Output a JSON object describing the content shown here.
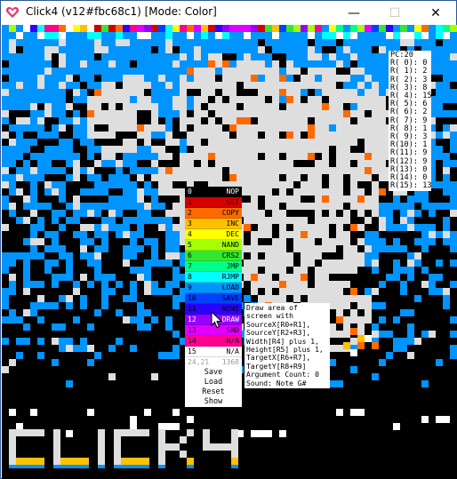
{
  "window": {
    "title": "Click4 (v12#fbc68c1) [Mode: Color]",
    "app_icon": "heart-icon",
    "controls": {
      "minimize": "—",
      "maximize": "☐",
      "close": "✕"
    }
  },
  "registers": {
    "pc": "PC:20",
    "lines": [
      "R( 0): 0",
      "R( 1): 2",
      "R( 2): 3",
      "R( 3): 8",
      "R( 4): 15",
      "R( 5): 6",
      "R( 6): 2",
      "R( 7): 9",
      "R( 8): 1",
      "R( 9): 3",
      "R(10): 1",
      "R(11): 9",
      "R(12): 9",
      "R(13): 0",
      "R(14): 0",
      "R(15): 13"
    ]
  },
  "opcodes": [
    {
      "num": "0",
      "name": "NOP",
      "color": "#000000",
      "text": "#ffffff"
    },
    {
      "num": "1",
      "name": "SET",
      "color": "#d40000",
      "text": "#000000"
    },
    {
      "num": "2",
      "name": "COPY",
      "color": "#ff6a00",
      "text": "#000000"
    },
    {
      "num": "3",
      "name": "INC",
      "color": "#ffc000",
      "text": "#000000"
    },
    {
      "num": "4",
      "name": "DEC",
      "color": "#ffff00",
      "text": "#000000"
    },
    {
      "num": "5",
      "name": "NAND",
      "color": "#a6ff00",
      "text": "#000000"
    },
    {
      "num": "6",
      "name": "CRS2",
      "color": "#30e830",
      "text": "#000000"
    },
    {
      "num": "7",
      "name": "JMP",
      "color": "#00ff88",
      "text": "#000000"
    },
    {
      "num": "8",
      "name": "RJMP",
      "color": "#00ffff",
      "text": "#000000"
    },
    {
      "num": "9",
      "name": "LOAD",
      "color": "#0094ff",
      "text": "#000000"
    },
    {
      "num": "10",
      "name": "SAVE",
      "color": "#0040ff",
      "text": "#000000"
    },
    {
      "num": "11",
      "name": "NEWI",
      "color": "#2a00ff",
      "text": "#000000"
    },
    {
      "num": "12",
      "name": "DRAW",
      "color": "#9600ff",
      "text": "#ffffff"
    },
    {
      "num": "13",
      "name": "SND",
      "color": "#e000ff",
      "text": "#000000"
    },
    {
      "num": "14",
      "name": "N/A",
      "color": "#ff0090",
      "text": "#000000"
    },
    {
      "num": "15",
      "name": "N/A",
      "color": "#ffffff",
      "text": "#000000"
    }
  ],
  "status": {
    "position": "24,21",
    "value": "1368"
  },
  "commands": {
    "save": "Save",
    "load": "Load",
    "reset": "Reset",
    "show": "Show"
  },
  "tooltip": {
    "lines": [
      "Draw area of",
      "screen with",
      "SourceX[R0+R1],",
      "SourceY[R2+R3],",
      "Width[R4] plus 1,",
      "Height[R5] plus 1,",
      "TargetX[R6+R7],",
      "TargetY[R8+R9]",
      "Argument Count: 0",
      "Sound: Note G#"
    ]
  },
  "logo": {
    "text": "CLICK4"
  },
  "palette": {
    "blue": "#0094ff",
    "gray": "#dedede",
    "black": "#000000",
    "orange": "#ff6a00",
    "yellow": "#ffc000"
  }
}
